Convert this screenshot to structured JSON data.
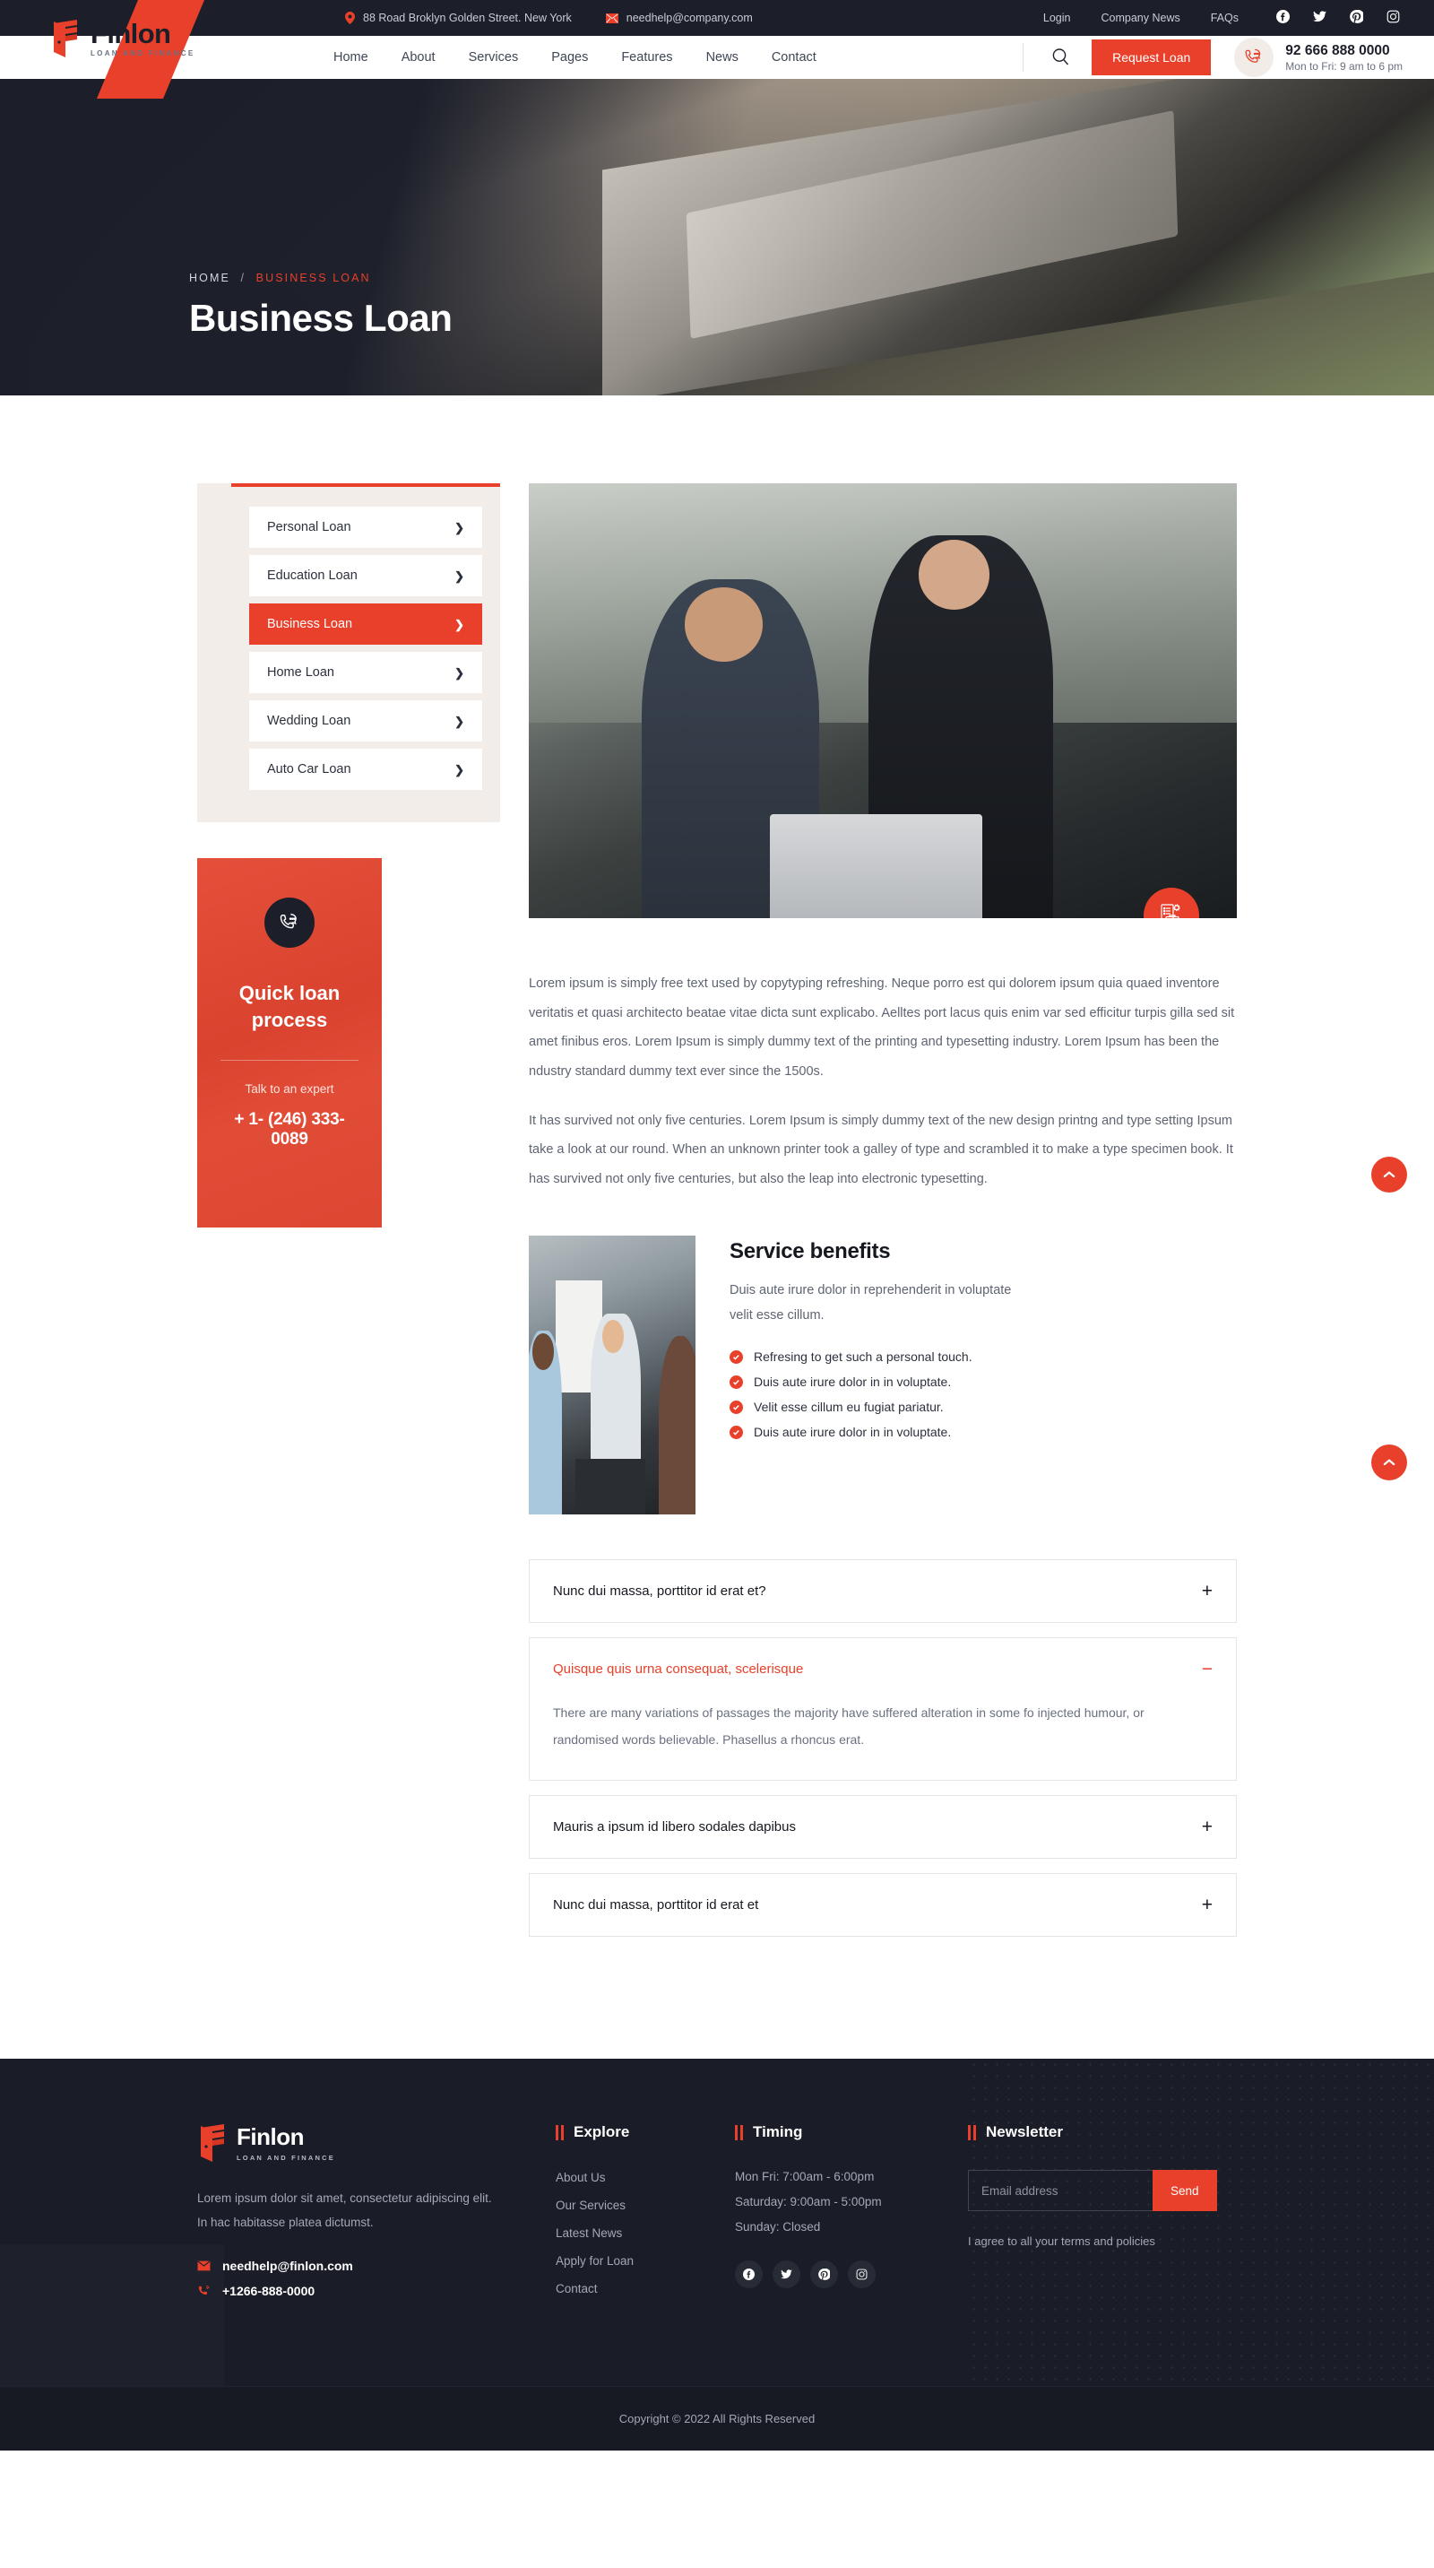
{
  "topbar": {
    "address": "88 Road Broklyn Golden Street. New York",
    "email": "needhelp@company.com",
    "links": [
      {
        "label": "Login"
      },
      {
        "label": "Company News"
      },
      {
        "label": "FAQs"
      }
    ],
    "socials": [
      {
        "name": "facebook-icon"
      },
      {
        "name": "twitter-icon"
      },
      {
        "name": "pinterest-icon"
      },
      {
        "name": "instagram-icon"
      }
    ]
  },
  "brand": {
    "name": "Finlon",
    "tagline": "LOAN AND FINANCE"
  },
  "nav": {
    "items": [
      {
        "label": "Home"
      },
      {
        "label": "About"
      },
      {
        "label": "Services"
      },
      {
        "label": "Pages"
      },
      {
        "label": "Features"
      },
      {
        "label": "News"
      },
      {
        "label": "Contact"
      }
    ],
    "request_loan": "Request Loan",
    "phone": "92 666 888 0000",
    "hours": "Mon to Fri: 9 am to 6 pm"
  },
  "hero": {
    "crumb_home": "HOME",
    "crumb_sep": "/",
    "crumb_current": "BUSINESS LOAN",
    "title": "Business Loan"
  },
  "sidebar": {
    "categories": [
      {
        "label": "Personal Loan",
        "active": false
      },
      {
        "label": "Education Loan",
        "active": false
      },
      {
        "label": "Business Loan",
        "active": true
      },
      {
        "label": "Home Loan",
        "active": false
      },
      {
        "label": "Wedding Loan",
        "active": false
      },
      {
        "label": "Auto Car Loan",
        "active": false
      }
    ],
    "quick": {
      "title": "Quick loan process",
      "subtitle": "Talk to an expert",
      "phone": "+ 1- (246) 333-0089"
    }
  },
  "content": {
    "paragraph_1": "Lorem ipsum is simply free text used by copytyping refreshing. Neque porro est qui dolorem ipsum quia quaed inventore veritatis et quasi architecto beatae vitae dicta sunt explicabo. Aelltes port lacus quis enim var sed efficitur turpis gilla sed sit amet finibus eros. Lorem Ipsum is simply dummy text of the printing and typesetting industry. Lorem Ipsum has been the ndustry standard dummy text ever since the 1500s.",
    "paragraph_2": "It has survived not only five centuries. Lorem Ipsum is simply dummy text of the new design printng and type setting Ipsum take a look at our round. When an unknown printer took a galley of type and scrambled it to make a type specimen book. It has survived not only five centuries, but also the leap into electronic typesetting."
  },
  "benefits": {
    "title": "Service benefits",
    "description": "Duis aute irure dolor in reprehenderit in voluptate velit esse cillum.",
    "items": [
      {
        "label": "Refresing to get such a personal touch."
      },
      {
        "label": "Duis aute irure dolor in in voluptate."
      },
      {
        "label": "Velit esse cillum eu fugiat pariatur."
      },
      {
        "label": "Duis aute irure dolor in in voluptate."
      }
    ]
  },
  "faq": {
    "items": [
      {
        "question": "Nunc dui massa, porttitor id erat et?",
        "sign": "+",
        "open": false,
        "answer": ""
      },
      {
        "question": "Quisque quis urna consequat, scelerisque",
        "sign": "−",
        "open": true,
        "answer": "There are many variations of passages the majority have suffered alteration in some fo injected humour, or randomised words believable. Phasellus a rhoncus erat."
      },
      {
        "question": "Mauris a ipsum id libero sodales dapibus",
        "sign": "+",
        "open": false,
        "answer": ""
      },
      {
        "question": "Nunc dui massa, porttitor id erat et",
        "sign": "+",
        "open": false,
        "answer": ""
      }
    ]
  },
  "footer": {
    "about": "Lorem ipsum dolor sit amet, consectetur adipiscing elit. In hac habitasse platea dictumst.",
    "email": "needhelp@finlon.com",
    "phone": "+1266-888-0000",
    "explore": {
      "title": "Explore",
      "links": [
        {
          "label": "About Us"
        },
        {
          "label": "Our Services"
        },
        {
          "label": "Latest News"
        },
        {
          "label": "Apply for Loan"
        },
        {
          "label": "Contact"
        }
      ]
    },
    "timing": {
      "title": "Timing",
      "rows": [
        {
          "label": "Mon Fri: 7:00am - 6:00pm"
        },
        {
          "label": "Saturday: 9:00am - 5:00pm"
        },
        {
          "label": "Sunday: Closed"
        }
      ],
      "socials": [
        {
          "name": "facebook-icon"
        },
        {
          "name": "twitter-icon"
        },
        {
          "name": "pinterest-icon"
        },
        {
          "name": "instagram-icon"
        }
      ]
    },
    "newsletter": {
      "title": "Newsletter",
      "placeholder": "Email address",
      "value": "",
      "send_label": "Send",
      "note": "I agree to all your terms and policies"
    },
    "copyright": "Copyright © 2022 All Rights Reserved"
  },
  "colors": {
    "accent": "#e8402a",
    "dark": "#1c1f2a",
    "footer_bg": "#1a1d27",
    "sidebar_bg": "#f2ede9"
  }
}
